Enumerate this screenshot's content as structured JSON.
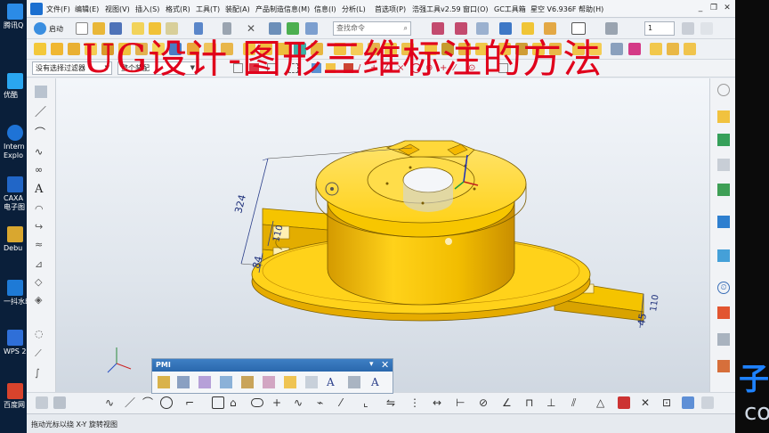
{
  "desktop": {
    "icons": [
      {
        "label": "腾讯Q",
        "color": "#2b8be6"
      },
      {
        "label": "优酷",
        "color": "#2aa6f0"
      },
      {
        "label": "Intern Explo",
        "color": "#1e73d6"
      },
      {
        "label": "CAXA 电子图",
        "color": "#2166c7"
      },
      {
        "label": "Debu",
        "color": "#d9a72f"
      },
      {
        "label": "一抖水印",
        "color": "#1e7ad6"
      },
      {
        "label": "WPS 2",
        "color": "#2f6fd8"
      },
      {
        "label": "百度网",
        "color": "#d8432c"
      }
    ]
  },
  "menubar": {
    "items": [
      "文件(F)",
      "编辑(E)",
      "视图(V)",
      "插入(S)",
      "格式(R)",
      "工具(T)",
      "装配(A)",
      "产品制造信息(M)",
      "信息(I)",
      "分析(L)",
      "首选项(P)",
      "浩强工具v2.59",
      "窗口(O)",
      "GC工具箱",
      "星空 V6.936F",
      "帮助(H)"
    ],
    "window_controls": [
      "_",
      "❐",
      "✕"
    ]
  },
  "toolbar1": {
    "start_label": "启动",
    "command_search_placeholder": "查找命令",
    "layer_value": "1"
  },
  "filterbar": {
    "selection_filter": "没有选择过滤器",
    "assembly_scope": "整个装配"
  },
  "viewport": {
    "overlay_title": "UG设计-图形三维标注的方法",
    "dimensions": [
      "324",
      "110",
      "84",
      "45",
      "110"
    ],
    "colors": {
      "part": "#f7c600",
      "part_shadow": "#d19b00",
      "dimension": "#2b3f8a",
      "title": "#e0001b"
    }
  },
  "pmi_panel": {
    "title": "PMI",
    "menu_glyph": "▾",
    "close_glyph": "✕"
  },
  "statusbar": {
    "text": "拖动光标以绕 X-Y 旋转视图"
  },
  "brand": {
    "line1": "子石",
    "line2": "co"
  }
}
